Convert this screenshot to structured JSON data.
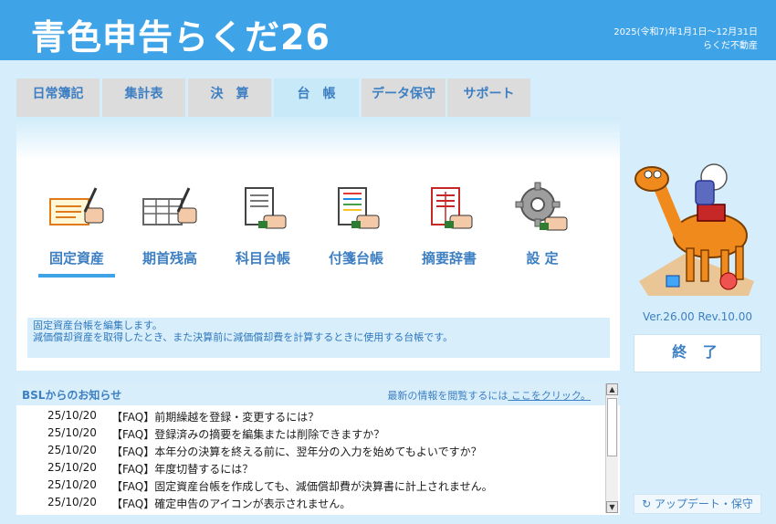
{
  "app": {
    "logo": "青色申告らくだ26",
    "period": "2025(令和7)年1月1日～12月31日",
    "business": "らくだ不動産"
  },
  "tabs": [
    {
      "label": "日常簿記"
    },
    {
      "label": "集計表"
    },
    {
      "label": "決　算"
    },
    {
      "label": "台　帳",
      "active": true
    },
    {
      "label": "データ保守"
    },
    {
      "label": "サポート"
    }
  ],
  "functions": [
    {
      "label": "固定資産",
      "icon": "fixed-asset-icon",
      "active": true
    },
    {
      "label": "期首残高",
      "icon": "opening-balance-icon"
    },
    {
      "label": "科目台帳",
      "icon": "account-ledger-icon"
    },
    {
      "label": "付箋台帳",
      "icon": "sticky-ledger-icon"
    },
    {
      "label": "摘要辞書",
      "icon": "summary-dictionary-icon"
    },
    {
      "label": "設 定",
      "icon": "gear-icon"
    }
  ],
  "description": {
    "line1": "固定資産台帳を編集します。",
    "line2": "減価償却資産を取得したとき、また決算前に減価償却費を計算するときに使用する台帳です。"
  },
  "news": {
    "title": "BSLからのお知らせ",
    "hint_prefix": "最新の情報を閲覧するには",
    "hint_link": " ここをクリック。",
    "items": [
      {
        "date": "25/10/20",
        "text": "【FAQ】前期繰越を登録・変更するには？"
      },
      {
        "date": "25/10/20",
        "text": "【FAQ】登録済みの摘要を編集または削除できますか？"
      },
      {
        "date": "25/10/20",
        "text": "【FAQ】本年分の決算を終える前に、翌年分の入力を始めてもよいですか？"
      },
      {
        "date": "25/10/20",
        "text": "【FAQ】年度切替するには？"
      },
      {
        "date": "25/10/20",
        "text": "【FAQ】固定資産台帳を作成しても、減価償却費が決算書に計上されません。"
      },
      {
        "date": "25/10/20",
        "text": "【FAQ】確定申告のアイコンが表示されません。"
      }
    ]
  },
  "side": {
    "version": "Ver.26.00 Rev.10.00",
    "exit_label": "終 了",
    "update_label": "↻ アップデート・保守"
  },
  "colors": {
    "header": "#3fa3e8",
    "accent": "#3d7fc2",
    "background": "#d6eefb"
  }
}
